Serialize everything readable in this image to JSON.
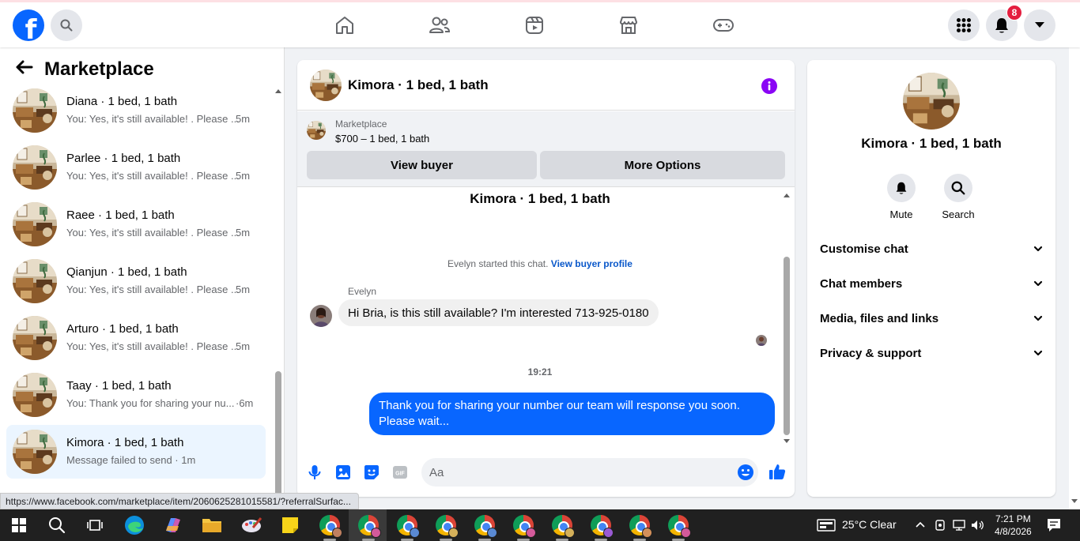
{
  "topnav": {
    "logo_letter": "f",
    "notification_count": "8",
    "icons": [
      "search-icon",
      "home-icon",
      "friends-icon",
      "video-icon",
      "marketplace-icon",
      "gaming-icon",
      "menu-grid-icon",
      "bell-icon",
      "account-caret-icon"
    ],
    "accent_color": "#0866ff"
  },
  "sidebar": {
    "title": "Marketplace",
    "conversations": [
      {
        "name": "",
        "message": "You: Yes, it's still available! . Please ...",
        "time": "5m"
      },
      {
        "name": "Diana · 1 bed, 1 bath",
        "message": "You: Yes, it's still available! . Please ...",
        "time": "5m"
      },
      {
        "name": "Parlee · 1 bed, 1 bath",
        "message": "You: Yes, it's still available! . Please ...",
        "time": "5m"
      },
      {
        "name": "Raee · 1 bed, 1 bath",
        "message": "You: Yes, it's still available! . Please ...",
        "time": "5m"
      },
      {
        "name": "Qianjun · 1 bed, 1 bath",
        "message": "You: Yes, it's still available! . Please ...",
        "time": "5m"
      },
      {
        "name": "Arturo · 1 bed, 1 bath",
        "message": "You: Yes, it's still available! . Please ...",
        "time": "5m"
      },
      {
        "name": "Taay · 1 bed, 1 bath",
        "message": "You: Thank you for sharing your nu...",
        "time": "·6m"
      },
      {
        "name": "Kimora · 1 bed, 1 bath",
        "message": "Message failed to send · 1m",
        "time": ""
      }
    ],
    "status_url": "https://www.facebook.com/marketplace/item/2060625281015581/?referralSurfac..."
  },
  "chat": {
    "title": "Kimora · 1 bed, 1 bath",
    "listing": {
      "label": "Marketplace",
      "price_title": "$700 – 1 bed, 1 bath",
      "view_buyer": "View buyer",
      "more_options": "More Options"
    },
    "convo_title": "Kimora · 1 bed, 1 bath",
    "started_text": "Evelyn started this chat.",
    "started_link": "View buyer profile",
    "sender_name": "Evelyn",
    "incoming_message": "Hi Bria, is this still available?  I'm interested 713-925-0180",
    "time_separator": "19:21",
    "outgoing_message": "Thank you for sharing your number our team will response you soon. Please wait...",
    "input_placeholder": "Aa"
  },
  "details": {
    "name": "Kimora · 1 bed, 1 bath",
    "mute_label": "Mute",
    "search_label": "Search",
    "sections": [
      "Customise chat",
      "Chat members",
      "Media, files and links",
      "Privacy & support"
    ]
  },
  "taskbar": {
    "weather": "25°C  Clear",
    "time": "7:21 PM",
    "date": "4/8/2026"
  }
}
